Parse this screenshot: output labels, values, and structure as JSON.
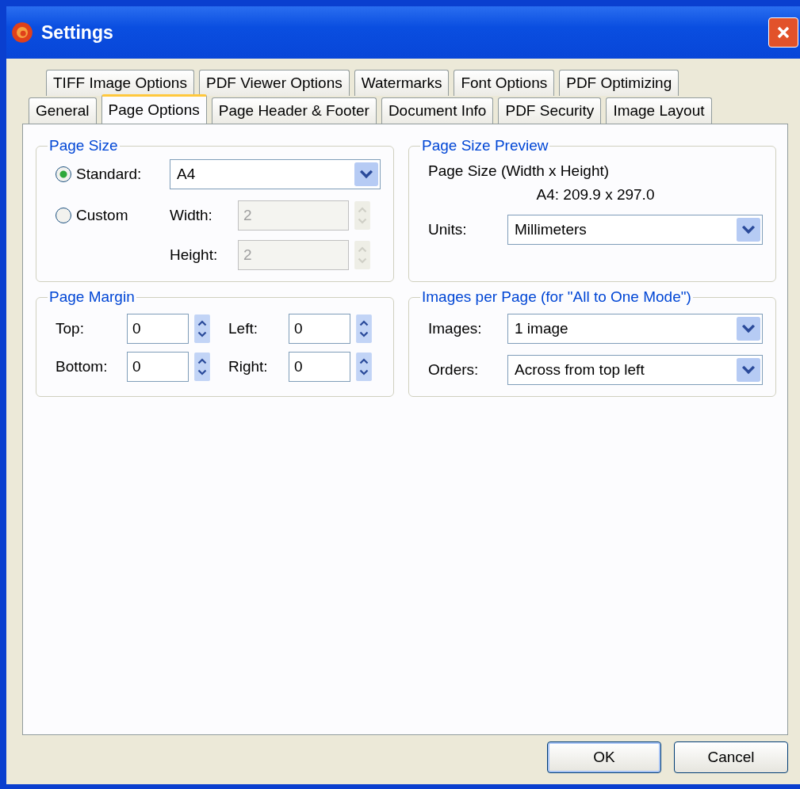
{
  "window": {
    "title": "Settings"
  },
  "tab_rows": [
    [
      {
        "label": "TIFF Image Options",
        "selected": false
      },
      {
        "label": "PDF Viewer Options",
        "selected": false
      },
      {
        "label": "Watermarks",
        "selected": false
      },
      {
        "label": "Font Options",
        "selected": false
      },
      {
        "label": "PDF Optimizing",
        "selected": false
      }
    ],
    [
      {
        "label": "General",
        "selected": false
      },
      {
        "label": "Page Options",
        "selected": true
      },
      {
        "label": "Page Header & Footer",
        "selected": false
      },
      {
        "label": "Document Info",
        "selected": false
      },
      {
        "label": "PDF Security",
        "selected": false
      },
      {
        "label": "Image Layout",
        "selected": false
      }
    ]
  ],
  "page_size": {
    "title": "Page Size",
    "options": [
      {
        "label": "Standard:",
        "selected": true
      },
      {
        "label": "Custom",
        "selected": false
      }
    ],
    "standard_value": "A4",
    "custom_fields": [
      {
        "label": "Width:",
        "value": "2",
        "disabled": true
      },
      {
        "label": "Height:",
        "value": "2",
        "disabled": true
      }
    ]
  },
  "preview": {
    "title": "Page Size Preview",
    "caption": "Page Size (Width x Height)",
    "size_text": "A4: 209.9 x 297.0",
    "units": {
      "label": "Units:",
      "value": "Millimeters"
    }
  },
  "page_margin": {
    "title": "Page Margin",
    "fields": [
      {
        "label": "Top:",
        "value": "0"
      },
      {
        "label": "Left:",
        "value": "0"
      },
      {
        "label": "Bottom:",
        "value": "0"
      },
      {
        "label": "Right:",
        "value": "0"
      }
    ]
  },
  "images_per_page": {
    "title": "Images per Page (for \"All to One Mode\")",
    "fields": [
      {
        "label": "Images:",
        "value": "1 image"
      },
      {
        "label": "Orders:",
        "value": "Across from top left"
      }
    ]
  },
  "buttons": [
    {
      "label": "OK",
      "default": true
    },
    {
      "label": "Cancel",
      "default": false
    }
  ]
}
